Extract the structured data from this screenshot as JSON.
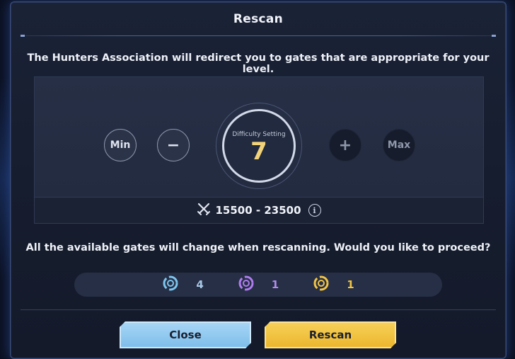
{
  "dialog": {
    "title": "Rescan",
    "description": "The Hunters Association will redirect you to gates that are appropriate for your level."
  },
  "difficulty": {
    "min_label": "Min",
    "minus_label": "−",
    "setting_label": "Difficulty Setting",
    "value": "7",
    "plus_label": "+",
    "max_label": "Max",
    "power_range": "15500 - 23500",
    "info_label": "i"
  },
  "question": "All the available gates will change when rescanning. Would you like to proceed?",
  "gates": [
    {
      "icon": "blue-gate-icon",
      "color": "#7cc6f0",
      "count": "4"
    },
    {
      "icon": "purple-gate-icon",
      "color": "#b07cf0",
      "count": "1"
    },
    {
      "icon": "gold-gate-icon",
      "color": "#f2c445",
      "count": "1"
    }
  ],
  "actions": {
    "close_label": "Close",
    "rescan_label": "Rescan"
  }
}
